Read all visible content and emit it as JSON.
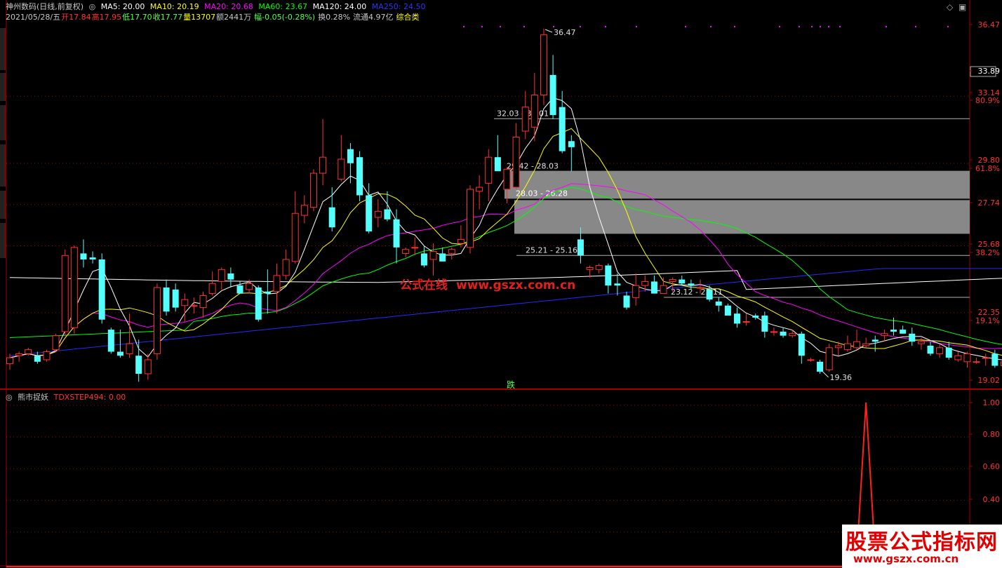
{
  "header": {
    "stock": "神州数码(日线,前复权)",
    "ma": [
      {
        "label": "MA5: 20.00",
        "color": "#ffffff"
      },
      {
        "label": "MA10: 20.19",
        "color": "#ffff00"
      },
      {
        "label": "MA20: 20.68",
        "color": "#ff00ff"
      },
      {
        "label": "MA60: 23.67",
        "color": "#00ff00"
      },
      {
        "label": "MA120: 24.00",
        "color": "#ffffff"
      },
      {
        "label": "MA250: 24.50",
        "color": "#3030ff"
      }
    ]
  },
  "info": {
    "date": "2021/05/28/五",
    "open_label": "开",
    "open": "17.84",
    "high_label": "高",
    "high": "17.95",
    "low_label": "低",
    "low": "17.70",
    "close_label": "收",
    "close": "17.77",
    "vol_label": "量",
    "vol": "13707",
    "amt": "额2441万",
    "chg": "幅-0.05(-0.28%)",
    "turn": "换0.28%",
    "float": "流通4.97亿",
    "sector": "综合类"
  },
  "colors": {
    "up": "#ff3232",
    "down": "#54ffff",
    "grid": "#a00000",
    "ma5": "#ffffff",
    "ma10": "#ffff00",
    "ma20": "#ff00ff",
    "ma60": "#00ff00",
    "ma120": "#ffffff",
    "ma250": "#2828ff"
  },
  "price_axis": {
    "ticks": [
      {
        "v": "36.47",
        "c": "#ff3232"
      },
      {
        "v": "33.89",
        "c": "#ffffff",
        "boxed": true
      },
      {
        "v": "33.14",
        "c": "#ff3232"
      },
      {
        "v": "80.9%",
        "c": "#ff3232"
      },
      {
        "v": "29.80",
        "c": "#ff3232"
      },
      {
        "v": "61.8%",
        "c": "#ff3232"
      },
      {
        "v": "27.74",
        "c": "#ff3232"
      },
      {
        "v": "25.68",
        "c": "#ff3232"
      },
      {
        "v": "38.2%",
        "c": "#ff3232"
      },
      {
        "v": "22.35",
        "c": "#ff3232"
      },
      {
        "v": "19.1%",
        "c": "#ff3232"
      },
      {
        "v": "19.02",
        "c": "#ff3232"
      }
    ]
  },
  "annotations": {
    "high": "36.47",
    "low": "19.36",
    "fib": [
      "32.03 - 32.01",
      "29.42 - 28.03",
      "28.03 - 26.28",
      "25.21 - 25.16",
      "23.12 - 23.11"
    ],
    "signal": "跌"
  },
  "sub": {
    "title": "熊市捉妖",
    "indicator": "TDXSTEP494: 0.00",
    "ticks": [
      "1.00",
      "0.80",
      "0.60",
      "0.40"
    ]
  },
  "watermark": {
    "center_cn": "公式在线",
    "center_en": "www.gszx.com.cn",
    "line1": "股票公式指标网",
    "line2": "www.gszx.com.cn"
  },
  "chart_data": {
    "type": "candlestick",
    "candles": [
      [
        19.8,
        20.3,
        19.5,
        20.1
      ],
      [
        20.2,
        20.4,
        19.9,
        20.3
      ],
      [
        20.3,
        20.6,
        20.2,
        20.5
      ],
      [
        20.2,
        20.4,
        19.8,
        19.9
      ],
      [
        20.0,
        20.5,
        19.9,
        20.4
      ],
      [
        20.5,
        21.3,
        20.4,
        21.2
      ],
      [
        21.4,
        25.5,
        21.2,
        25.2
      ],
      [
        21.6,
        25.7,
        21.3,
        25.6
      ],
      [
        25.3,
        26.0,
        24.6,
        25.0
      ],
      [
        25.1,
        25.4,
        24.8,
        25.0
      ],
      [
        25.0,
        25.3,
        21.8,
        22.0
      ],
      [
        21.5,
        21.6,
        20.3,
        20.4
      ],
      [
        20.4,
        21.5,
        20.1,
        20.2
      ],
      [
        20.3,
        22.3,
        20.1,
        20.8
      ],
      [
        20.2,
        21.0,
        18.9,
        19.3
      ],
      [
        19.3,
        20.3,
        19.0,
        20.0
      ],
      [
        20.3,
        23.8,
        20.0,
        23.6
      ],
      [
        23.6,
        24.0,
        22.2,
        22.4
      ],
      [
        23.5,
        23.8,
        22.4,
        22.6
      ],
      [
        22.7,
        23.3,
        21.9,
        23.0
      ],
      [
        22.7,
        23.1,
        22.3,
        22.7
      ],
      [
        22.6,
        23.4,
        22.1,
        23.2
      ],
      [
        23.3,
        24.4,
        23.2,
        23.8
      ],
      [
        23.9,
        24.6,
        23.5,
        24.5
      ],
      [
        24.3,
        24.6,
        23.6,
        24.0
      ],
      [
        23.7,
        23.9,
        23.3,
        23.3
      ],
      [
        23.5,
        24.0,
        23.3,
        23.8
      ],
      [
        23.6,
        23.7,
        21.9,
        22.0
      ],
      [
        23.4,
        24.5,
        22.3,
        23.3
      ],
      [
        23.4,
        24.8,
        22.3,
        24.2
      ],
      [
        24.2,
        25.5,
        24.0,
        25.0
      ],
      [
        24.9,
        28.4,
        24.8,
        27.3
      ],
      [
        27.2,
        28.2,
        26.8,
        27.7
      ],
      [
        27.6,
        29.5,
        27.4,
        29.3
      ],
      [
        29.3,
        32.0,
        28.7,
        30.1
      ],
      [
        27.6,
        28.6,
        26.4,
        26.6
      ],
      [
        29.0,
        31.2,
        28.9,
        30.0
      ],
      [
        30.5,
        30.8,
        28.8,
        29.8
      ],
      [
        30.1,
        30.4,
        27.9,
        28.2
      ],
      [
        28.2,
        28.8,
        26.3,
        26.4
      ],
      [
        27.1,
        28.0,
        26.6,
        27.4
      ],
      [
        27.5,
        28.4,
        26.9,
        27.0
      ],
      [
        27.0,
        27.5,
        24.8,
        25.6
      ],
      [
        25.3,
        25.6,
        25.1,
        25.5
      ],
      [
        25.6,
        26.1,
        25.2,
        25.6
      ],
      [
        25.3,
        25.7,
        24.6,
        24.7
      ],
      [
        25.0,
        25.8,
        24.2,
        25.4
      ],
      [
        25.3,
        25.6,
        24.9,
        24.9
      ],
      [
        25.3,
        25.6,
        25.0,
        25.5
      ],
      [
        25.8,
        26.7,
        25.6,
        26.0
      ],
      [
        25.6,
        28.7,
        25.3,
        28.5
      ],
      [
        28.4,
        29.2,
        27.5,
        28.6
      ],
      [
        28.8,
        30.5,
        27.9,
        30.1
      ],
      [
        30.1,
        31.2,
        29.5,
        29.4
      ],
      [
        28.5,
        29.6,
        27.8,
        29.5
      ],
      [
        28.6,
        31.8,
        28.5,
        31.1
      ],
      [
        31.4,
        33.4,
        31.0,
        32.6
      ],
      [
        31.6,
        34.3,
        30.9,
        33.2
      ],
      [
        33.2,
        36.5,
        32.7,
        36.2
      ],
      [
        34.2,
        35.2,
        32.0,
        32.2
      ],
      [
        32.6,
        33.4,
        30.3,
        30.4
      ],
      [
        30.9,
        31.2,
        29.4,
        30.6
      ],
      [
        26.0,
        26.6,
        24.8,
        25.2
      ],
      [
        24.5,
        24.7,
        24.1,
        24.6
      ],
      [
        24.5,
        24.8,
        24.3,
        24.7
      ],
      [
        24.7,
        24.8,
        23.3,
        23.7
      ],
      [
        23.8,
        24.3,
        23.2,
        23.7
      ],
      [
        23.2,
        23.4,
        22.5,
        22.6
      ],
      [
        23.1,
        24.3,
        22.7,
        23.7
      ],
      [
        23.7,
        24.2,
        23.4,
        23.9
      ],
      [
        23.9,
        24.2,
        23.3,
        23.3
      ],
      [
        23.3,
        24.1,
        23.3,
        23.7
      ],
      [
        23.9,
        24.1,
        23.4,
        24.0
      ],
      [
        24.0,
        24.2,
        23.7,
        23.8
      ],
      [
        23.8,
        24.0,
        23.5,
        23.7
      ],
      [
        23.6,
        24.0,
        23.3,
        23.6
      ],
      [
        23.5,
        23.7,
        22.9,
        23.0
      ],
      [
        22.9,
        23.1,
        22.4,
        22.7
      ],
      [
        22.7,
        22.8,
        22.2,
        22.2
      ],
      [
        22.3,
        22.6,
        21.6,
        21.8
      ],
      [
        21.9,
        22.3,
        21.7,
        21.9
      ],
      [
        22.2,
        22.3,
        22.0,
        22.1
      ],
      [
        22.2,
        22.4,
        21.1,
        21.4
      ],
      [
        21.4,
        21.6,
        21.2,
        21.4
      ],
      [
        21.4,
        21.6,
        21.1,
        21.2
      ],
      [
        21.2,
        21.5,
        21.1,
        21.3
      ],
      [
        21.3,
        21.4,
        19.8,
        20.2
      ],
      [
        20.0,
        20.1,
        19.9,
        20.0
      ],
      [
        19.9,
        20.0,
        19.3,
        19.4
      ],
      [
        19.5,
        20.8,
        19.4,
        20.6
      ],
      [
        20.6,
        20.9,
        20.2,
        20.7
      ],
      [
        20.5,
        21.2,
        20.4,
        20.8
      ],
      [
        20.6,
        21.5,
        20.5,
        20.9
      ],
      [
        20.7,
        21.1,
        20.6,
        20.8
      ],
      [
        21.0,
        21.2,
        20.4,
        20.9
      ],
      [
        21.2,
        21.5,
        20.9,
        21.3
      ],
      [
        21.5,
        22.1,
        21.2,
        21.4
      ],
      [
        21.5,
        21.7,
        21.3,
        21.3
      ],
      [
        21.3,
        21.6,
        20.7,
        20.9
      ],
      [
        20.8,
        21.1,
        20.5,
        20.9
      ],
      [
        20.7,
        20.9,
        20.2,
        20.3
      ],
      [
        20.3,
        20.8,
        20.1,
        20.6
      ],
      [
        20.6,
        20.9,
        20.0,
        20.1
      ],
      [
        20.0,
        20.4,
        19.9,
        20.2
      ],
      [
        19.9,
        20.4,
        19.6,
        20.3
      ],
      [
        19.9,
        20.1,
        19.8,
        19.9
      ],
      [
        20.1,
        20.3,
        19.7,
        20.1
      ],
      [
        20.3,
        20.5,
        19.6,
        19.7
      ],
      [
        19.7,
        20.1,
        19.5,
        19.9
      ],
      [
        19.8,
        19.9,
        19.3,
        19.5
      ],
      [
        19.5,
        19.7,
        19.3,
        19.6
      ],
      [
        19.6,
        19.7,
        19.0,
        19.0
      ]
    ],
    "price_range": [
      19.02,
      36.47
    ],
    "fib_levels": [
      {
        "label": "32.03 - 32.01",
        "price": 32.02
      },
      {
        "label": "29.42 - 28.03",
        "top": 29.42,
        "bottom": 28.03
      },
      {
        "label": "28.03 - 26.28",
        "top": 28.03,
        "bottom": 26.28
      },
      {
        "label": "25.21 - 25.16",
        "price": 25.2
      },
      {
        "label": "23.12 - 23.11",
        "price": 23.11
      }
    ],
    "indicator": {
      "name": "TDXSTEP494",
      "value": 0.0,
      "ylim": [
        0,
        1
      ],
      "spike_index": 93,
      "spike_value": 1.0
    }
  }
}
